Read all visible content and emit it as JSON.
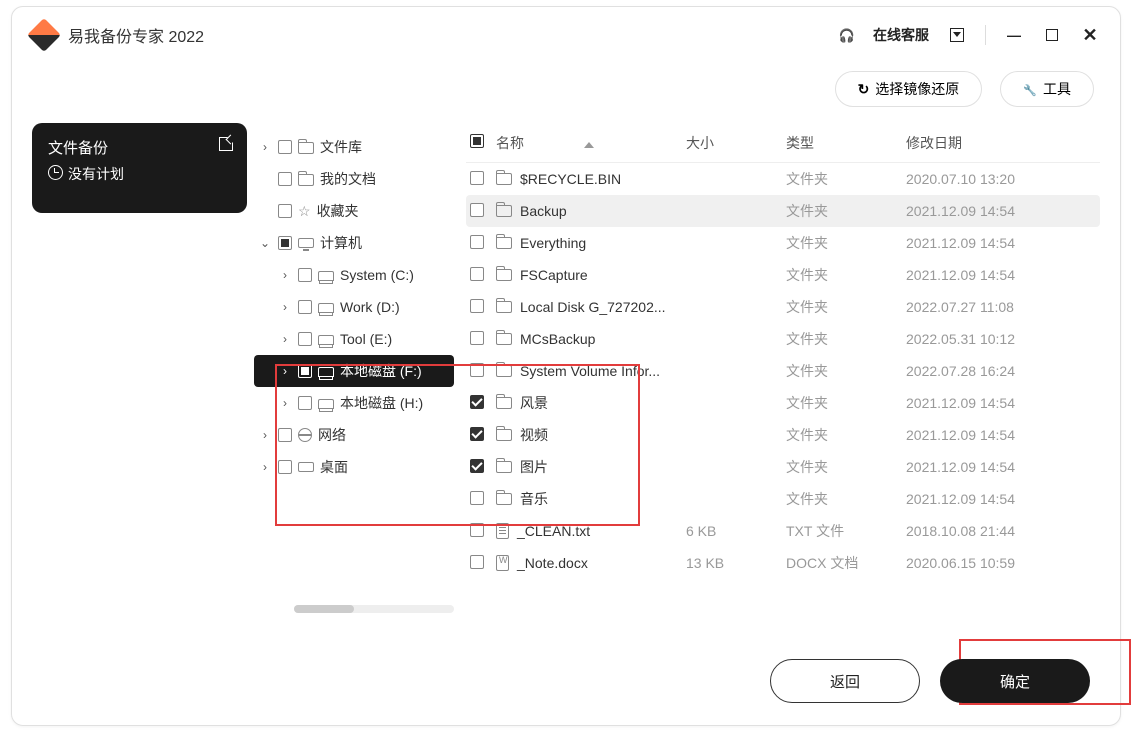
{
  "app": {
    "title": "易我备份专家 2022"
  },
  "titlebar": {
    "support": "在线客服"
  },
  "toolbar": {
    "restore": "选择镜像还原",
    "tools": "工具"
  },
  "task": {
    "title": "文件备份",
    "noplan": "没有计划"
  },
  "tree": {
    "lib": "文件库",
    "mydoc": "我的文档",
    "fav": "收藏夹",
    "computer": "计算机",
    "sysC": "System (C:)",
    "workD": "Work (D:)",
    "toolE": "Tool (E:)",
    "localF": "本地磁盘 (F:)",
    "localH": "本地磁盘 (H:)",
    "network": "网络",
    "desktop": "桌面"
  },
  "columns": {
    "name": "名称",
    "size": "大小",
    "type": "类型",
    "date": "修改日期"
  },
  "rows": [
    {
      "name": "$RECYCLE.BIN",
      "size": "",
      "type": "文件夹",
      "date": "2020.07.10 13:20",
      "checked": false,
      "icon": "folder",
      "sel": false
    },
    {
      "name": "Backup",
      "size": "",
      "type": "文件夹",
      "date": "2021.12.09 14:54",
      "checked": false,
      "icon": "folder",
      "sel": true
    },
    {
      "name": "Everything",
      "size": "",
      "type": "文件夹",
      "date": "2021.12.09 14:54",
      "checked": false,
      "icon": "folder",
      "sel": false
    },
    {
      "name": "FSCapture",
      "size": "",
      "type": "文件夹",
      "date": "2021.12.09 14:54",
      "checked": false,
      "icon": "folder",
      "sel": false
    },
    {
      "name": "Local Disk G_727202...",
      "size": "",
      "type": "文件夹",
      "date": "2022.07.27 11:08",
      "checked": false,
      "icon": "folder",
      "sel": false
    },
    {
      "name": "MCsBackup",
      "size": "",
      "type": "文件夹",
      "date": "2022.05.31 10:12",
      "checked": false,
      "icon": "folder",
      "sel": false
    },
    {
      "name": "System Volume Infor...",
      "size": "",
      "type": "文件夹",
      "date": "2022.07.28 16:24",
      "checked": false,
      "icon": "folder",
      "sel": false
    },
    {
      "name": "风景",
      "size": "",
      "type": "文件夹",
      "date": "2021.12.09 14:54",
      "checked": true,
      "icon": "folder",
      "sel": false
    },
    {
      "name": "视频",
      "size": "",
      "type": "文件夹",
      "date": "2021.12.09 14:54",
      "checked": true,
      "icon": "folder",
      "sel": false
    },
    {
      "name": "图片",
      "size": "",
      "type": "文件夹",
      "date": "2021.12.09 14:54",
      "checked": true,
      "icon": "folder",
      "sel": false
    },
    {
      "name": "音乐",
      "size": "",
      "type": "文件夹",
      "date": "2021.12.09 14:54",
      "checked": false,
      "icon": "folder",
      "sel": false
    },
    {
      "name": "_CLEAN.txt",
      "size": "6 KB",
      "type": "TXT 文件",
      "date": "2018.10.08 21:44",
      "checked": false,
      "icon": "file",
      "sel": false
    },
    {
      "name": "_Note.docx",
      "size": "13 KB",
      "type": "DOCX 文档",
      "date": "2020.06.15 10:59",
      "checked": false,
      "icon": "doc",
      "sel": false
    }
  ],
  "footer": {
    "back": "返回",
    "ok": "确定"
  }
}
